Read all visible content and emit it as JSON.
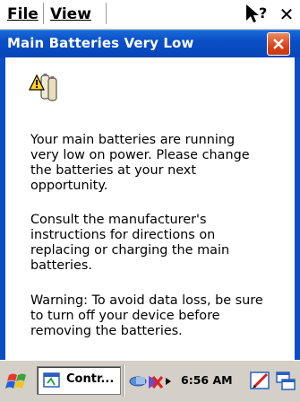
{
  "menubar": {
    "file_label": "File",
    "view_label": "View"
  },
  "dialog": {
    "title": "Main Batteries Very Low",
    "paragraph1": "Your main batteries are running\nvery low on power. Please change\nthe batteries at your next\nopportunity.",
    "paragraph2": "Consult the manufacturer's\ninstructions for directions on\nreplacing or charging the main\nbatteries.",
    "paragraph3": "Warning: To avoid data loss, be sure\nto turn off your device before\nremoving the batteries."
  },
  "taskbar": {
    "task_label": "Contr...",
    "clock": "6:56 AM"
  },
  "icons": {
    "start": "windows-flag-icon",
    "help": "help-pointer-icon",
    "battery": "battery-warning-icon",
    "task": "control-panel-icon",
    "network": "network-icon",
    "edit": "pen-icon",
    "tray_extra": "window-icon"
  },
  "colors": {
    "titlebar": "#0a4ec6",
    "close_button": "#d9431b",
    "taskbar": "#d4d0c8"
  }
}
